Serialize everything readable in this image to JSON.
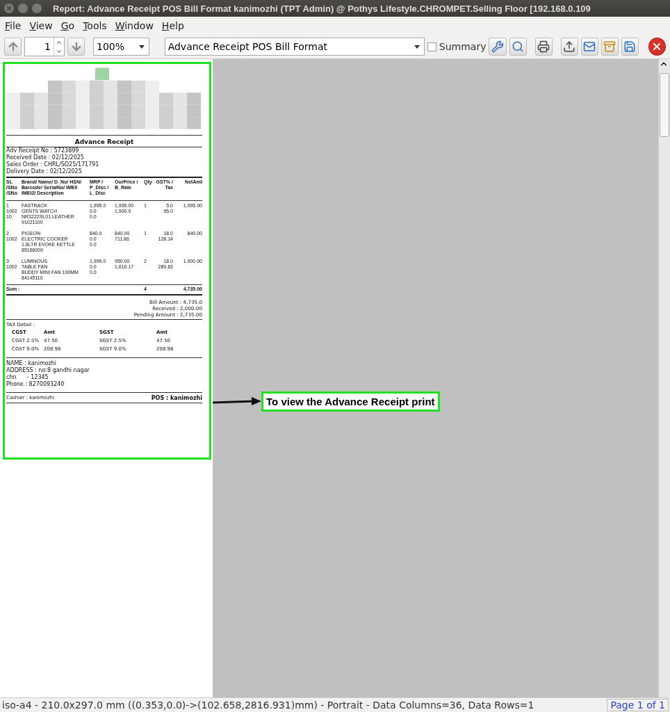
{
  "window": {
    "title": "Report: Advance Receipt POS Bill Format  kanimozhi (TPT Admin) @ Pothys Lifestyle.CHROMPET.Selling Floor [192.168.0.109"
  },
  "menu": [
    "File",
    "View",
    "Go",
    "Tools",
    "Window",
    "Help"
  ],
  "toolbar": {
    "page": "1",
    "zoom": "100%",
    "report": "Advance Receipt POS Bill Format",
    "summary": {
      "label": "Summary",
      "checked": false
    }
  },
  "receipt": {
    "title": "Advance Receipt",
    "info": [
      "Adv Receipt No : 5723899",
      "Received Date : 02/12/2025",
      "Sales Order : CHRL/SO25/171791",
      "Delivery Date : 02/12/2025"
    ],
    "columns": [
      "SL\n/SNo\n/SNo",
      "Brand/ Name/ D_No/ HSN/\nBarcode/ SerialNo/ IMEI/\nIMEI2/ Description",
      "MRP /\nP_Disc /\nL_Disc",
      "OurPrice /\nB_Rate",
      "Qty",
      "GST% /\nTax",
      "NetAmt"
    ],
    "rows": [
      {
        "cells": [
          [
            "1",
            "1002",
            "10"
          ],
          [
            "FASTRACK",
            "GENTS WATCH",
            "NR3222SL01 LEATHER",
            "91021100"
          ],
          [
            "1,995.0",
            "0.0",
            "0.0"
          ],
          [
            "1,995.00",
            "1,900.0"
          ],
          [
            "1"
          ],
          [
            "5.0",
            "95.0"
          ],
          [
            "1,995.00"
          ]
        ]
      },
      {
        "cells": [
          [
            "2",
            "1002"
          ],
          [
            "PIGEON",
            "ELECTRIC COOKER",
            "1.8LTR EVOKE KETTLE",
            "85166000"
          ],
          [
            "840.0",
            "0.0",
            "0.0"
          ],
          [
            "840.00",
            "711.86"
          ],
          [
            "1"
          ],
          [
            "18.0",
            "128.14"
          ],
          [
            "840.00"
          ]
        ]
      },
      {
        "cells": [
          [
            "3",
            "1002"
          ],
          [
            "LUMINOUS",
            "TABLE FAN",
            "BUDDY MINI FAN 100MM",
            "84145110"
          ],
          [
            "1,999.0",
            "0.0",
            "0.0"
          ],
          [
            "950.00",
            "1,610.17"
          ],
          [
            "2"
          ],
          [
            "18.0",
            "289.83"
          ],
          [
            "1,900.00"
          ]
        ]
      }
    ],
    "sum": {
      "label": "Sum :",
      "qty": "4",
      "net": "4,735.00"
    },
    "totals": [
      "Bill Amount : 4,735.0",
      "Received : 2,000.00",
      "Pending Amount : 2,735.00"
    ],
    "tax": {
      "title": "TAX Detail :",
      "headers": [
        "CGST",
        "Amt",
        "SGST",
        "Amt"
      ],
      "rows": [
        [
          "CGST 2.5%",
          "47.50",
          "SGST 2.5%",
          "47.50"
        ],
        [
          "CGST 9.0%",
          "208.98",
          "SGST 9.0%",
          "208.98"
        ]
      ]
    },
    "customer": [
      "NAME : kanimozhi",
      "ADDRESS : no:8 gandhi nagar",
      "chn      - 12345",
      "Phone : 8270093240"
    ],
    "cashier": "Cashier : kanimozhi",
    "pos": "POS : kanimozhi"
  },
  "annotation": "To view the Advance Receipt print",
  "status_bar": {
    "text": "iso-a4 - 210.0x297.0 mm ((0.353,0.0)->(102.658,2816.931)mm) - Portrait - Data Columns=36, Data Rows=1",
    "page": "Page 1 of 1"
  }
}
